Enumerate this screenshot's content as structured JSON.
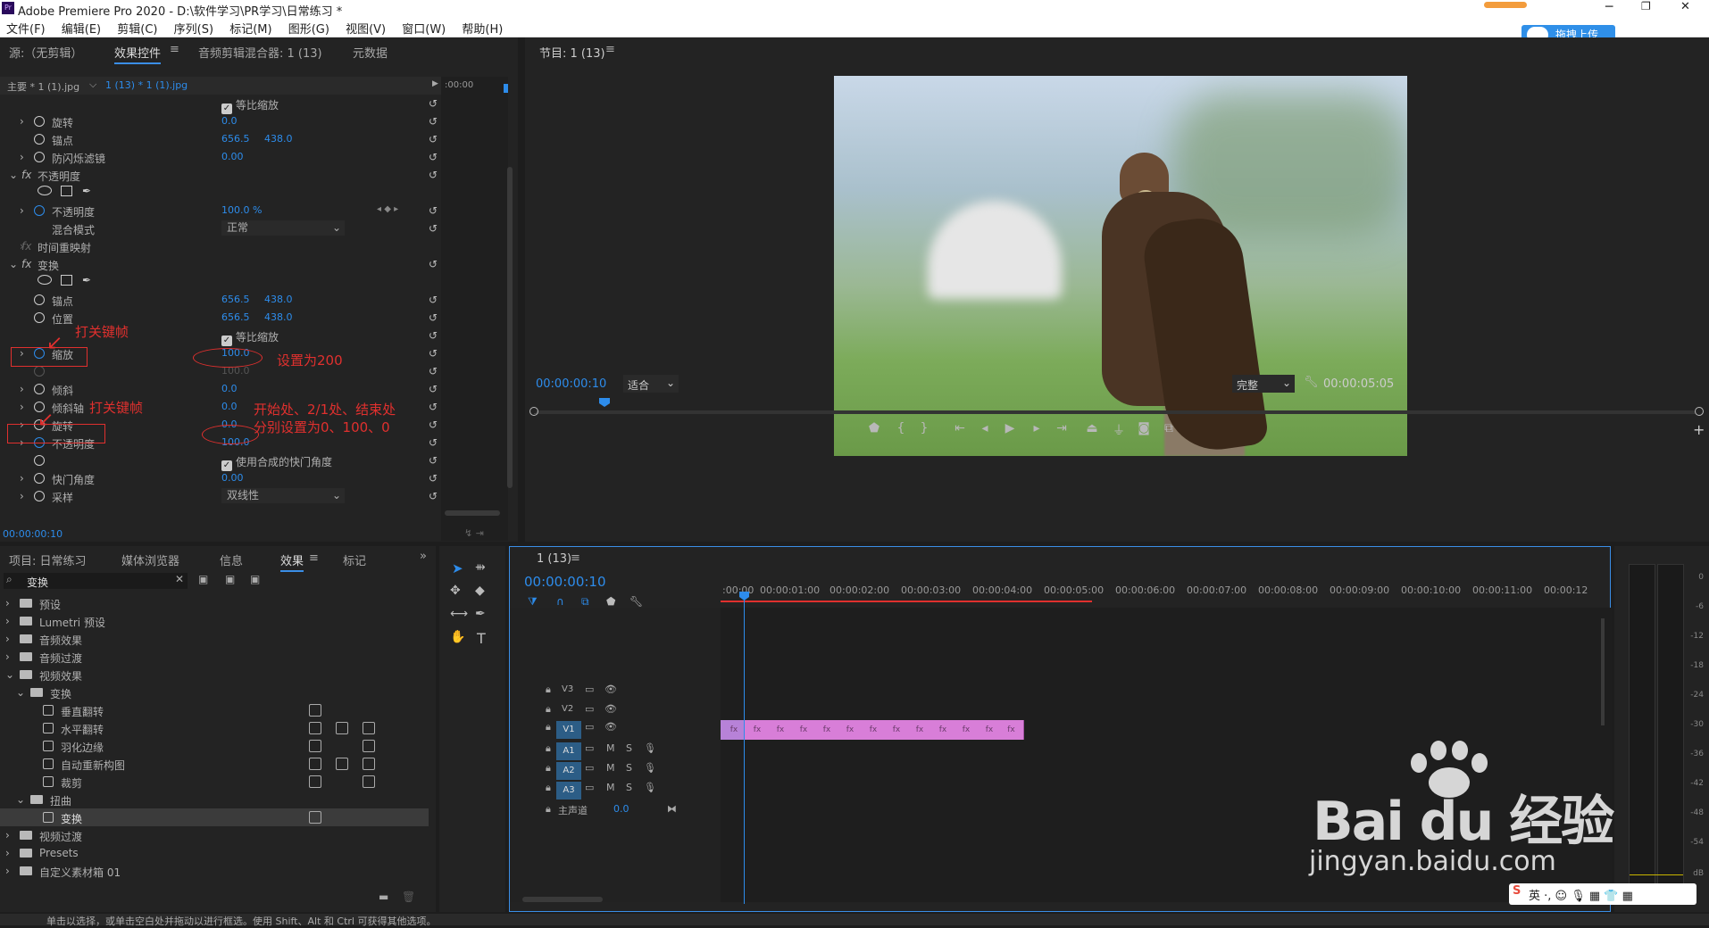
{
  "window": {
    "title": "Adobe Premiere Pro 2020 - D:\\软件学习\\PR学习\\日常练习 *",
    "app_icon": "Pr"
  },
  "menu": [
    "文件(F)",
    "编辑(E)",
    "剪辑(C)",
    "序列(S)",
    "标记(M)",
    "图形(G)",
    "视图(V)",
    "窗口(W)",
    "帮助(H)"
  ],
  "upload_button": "拖拽上传",
  "left_tabs": {
    "source": "源:（无剪辑）",
    "effect_controls": "效果控件",
    "audio_mixer": "音频剪辑混合器: 1 (13)",
    "metadata": "元数据"
  },
  "effect_controls": {
    "master": "主要 * 1 (1).jpg",
    "clip": "1 (13) * 1 (1).jpg",
    "ruler_time": ":00:00",
    "rows": {
      "uniform_scale_top": "等比缩放",
      "rotation": "旋转",
      "rotation_val": "0.0",
      "anchor": "锚点",
      "anchor_x": "656.5",
      "anchor_y": "438.0",
      "flicker": "防闪烁滤镜",
      "flicker_val": "0.00",
      "opacity_group": "不透明度",
      "opacity": "不透明度",
      "opacity_val": "100.0 %",
      "blend_mode": "混合模式",
      "blend_val": "正常",
      "time_remap": "时间重映射",
      "transform": "变换",
      "t_anchor": "锚点",
      "t_anchor_x": "656.5",
      "t_anchor_y": "438.0",
      "t_position": "位置",
      "t_pos_x": "656.5",
      "t_pos_y": "438.0",
      "t_uniform": "等比缩放",
      "t_scale": "缩放",
      "t_scale_val": "100.0",
      "t_scale_dim": "100.0",
      "t_skew": "倾斜",
      "t_skew_val": "0.0",
      "t_skew_axis": "倾斜轴",
      "t_skew_axis_val": "0.0",
      "t_rotation": "旋转",
      "t_rotation_val": "0.0",
      "t_opacity": "不透明度",
      "t_opacity_val": "100.0",
      "t_shutter_chk": "使用合成的快门角度",
      "t_shutter": "快门角度",
      "t_shutter_val": "0.00",
      "t_sampling": "采样",
      "t_sampling_val": "双线性"
    },
    "timecode": "00:00:00:10"
  },
  "annotations": {
    "keyframe1": "打关键帧",
    "set200": "设置为200",
    "keyframe2": "打关键帧",
    "note_line1": "开始处、2/1处、结束处",
    "note_line2": "分别设置为0、100、0"
  },
  "program": {
    "title": "节目: 1 (13)",
    "timecode": "00:00:00:10",
    "fit": "适合",
    "quality": "完整",
    "duration": "00:00:05:05"
  },
  "project_tabs": {
    "project": "项目: 日常练习",
    "media": "媒体浏览器",
    "info": "信息",
    "effects": "效果",
    "markers": "标记"
  },
  "search_value": "变换",
  "effects_tree": [
    "预设",
    "Lumetri 预设",
    "音频效果",
    "音频过渡",
    "视频效果",
    "变换",
    "垂直翻转",
    "水平翻转",
    "羽化边缘",
    "自动重新构图",
    "裁剪",
    "扭曲",
    "变换",
    "视频过渡",
    "Presets",
    "自定义素材箱 01"
  ],
  "timeline": {
    "title": "1 (13)",
    "timecode": "00:00:00:10",
    "ruler": [
      ":00:00",
      "00:00:01:00",
      "00:00:02:00",
      "00:00:03:00",
      "00:00:04:00",
      "00:00:05:00",
      "00:00:06:00",
      "00:00:07:00",
      "00:00:08:00",
      "00:00:09:00",
      "00:00:10:00",
      "00:00:11:00",
      "00:00:12"
    ],
    "tracks": {
      "v3": "V3",
      "v2": "V2",
      "v1": "V1",
      "a1": "A1",
      "a2": "A2",
      "a3": "A3",
      "master": "主声道",
      "master_val": "0.0",
      "m": "M",
      "s": "S"
    },
    "clip_label": "fx"
  },
  "meter_scale": [
    "0",
    "-6",
    "-12",
    "-18",
    "-24",
    "-30",
    "-36",
    "-42",
    "-48",
    "-54",
    "dB"
  ],
  "meter_solo": "S",
  "status": "单击以选择，或单击空白处并拖动以进行框选。使用 Shift、Alt 和 Ctrl 可获得其他选项。",
  "watermark": {
    "brand": "Bai du 经验",
    "url": "jingyan.baidu.com"
  },
  "colors": {
    "accent": "#2d8ceb",
    "annotation": "#e0302e",
    "clip": "#d87ed8",
    "playhead": "#2d8ceb"
  },
  "icons": [
    "pr-app-icon",
    "minimize-icon",
    "restore-icon",
    "close-icon",
    "stopwatch-icon",
    "reset-icon",
    "ellipse-mask-icon",
    "rect-mask-icon",
    "pen-mask-icon",
    "search-icon",
    "folder-icon",
    "play-icon",
    "selection-tool-icon",
    "razor-tool-icon",
    "hand-tool-icon",
    "type-tool-icon",
    "wrench-icon",
    "camera-icon",
    "lock-icon",
    "eye-icon",
    "mic-icon"
  ]
}
